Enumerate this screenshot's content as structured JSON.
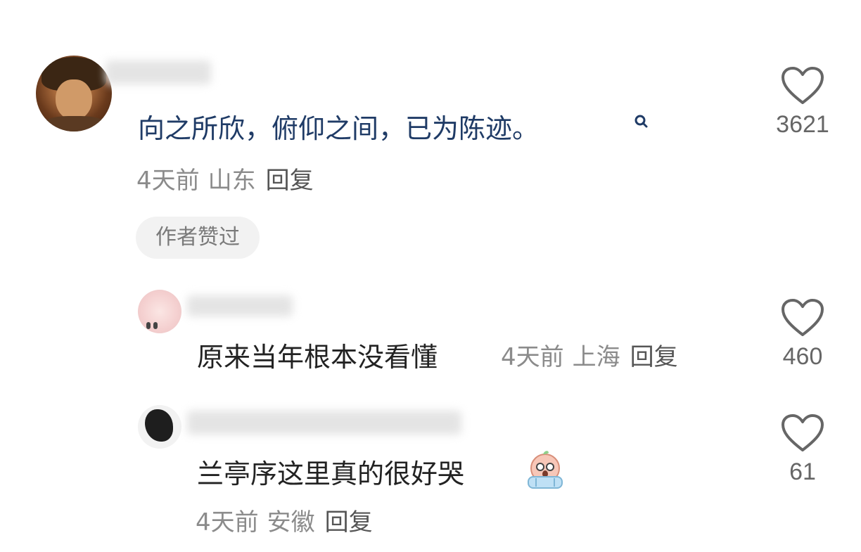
{
  "comments": [
    {
      "text": "向之所欣，俯仰之间，已为陈迹。",
      "time": "4天前",
      "location": "山东",
      "reply_label": "回复",
      "badge": "作者赞过",
      "likes": "3621"
    },
    {
      "text": "原来当年根本没看懂",
      "time": "4天前",
      "location": "上海",
      "reply_label": "回复",
      "likes": "460"
    },
    {
      "text": "兰亭序这里真的很好哭",
      "time": "4天前",
      "location": "安徽",
      "reply_label": "回复",
      "likes": "61"
    }
  ],
  "icons": {
    "like": "heart-outline-icon",
    "search": "search-icon",
    "emoji": "crying-emoji-icon"
  },
  "colors": {
    "highlight_text": "#1f3b66",
    "meta_text": "#8b8b8b",
    "badge_bg": "#f2f2f2"
  }
}
